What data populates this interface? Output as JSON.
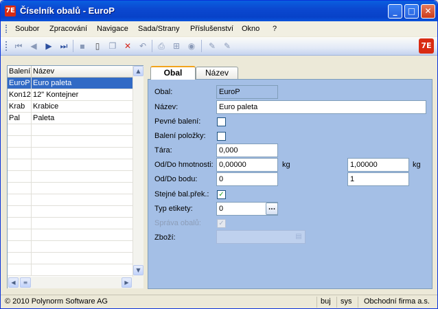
{
  "window": {
    "title": "Číselník obalů - EuroP",
    "icon_text": "7E",
    "controls": {
      "minimize": "_",
      "maximize": "□",
      "close": "✕"
    }
  },
  "menu": [
    "Soubor",
    "Zpracování",
    "Navigace",
    "Sada/Strany",
    "Příslušenství",
    "Okno",
    "?"
  ],
  "toolbar": {
    "icons": [
      "first-record-icon",
      "prev-record-icon",
      "next-record-icon",
      "last-record-icon",
      "save-icon",
      "new-icon",
      "copy-icon",
      "delete-icon",
      "undo-icon",
      "print-icon",
      "tree-icon",
      "refresh-icon",
      "edit-icon",
      "edit-alt-icon"
    ],
    "brand_text": "7E"
  },
  "grid": {
    "headers": [
      "Balení",
      "Název"
    ],
    "rows": [
      {
        "code": "EuroP",
        "name": "Euro paleta",
        "selected": true
      },
      {
        "code": "Kon12",
        "name": "12\" Kontejner"
      },
      {
        "code": "Krab",
        "name": "Krabice"
      },
      {
        "code": "Pal",
        "name": "Paleta"
      }
    ]
  },
  "tabs": [
    "Obal",
    "Název"
  ],
  "form": {
    "obal_label": "Obal:",
    "obal_value": "EuroP",
    "nazev_label": "Název:",
    "nazev_value": "Euro paleta",
    "pevne_label": "Pevné balení:",
    "pevne_checked": false,
    "baleni_pol_label": "Balení položky:",
    "baleni_pol_checked": false,
    "tara_label": "Tára:",
    "tara_value": "0,000",
    "hmot_label": "Od/Do hmotnosti:",
    "hmot_from": "0,00000",
    "hmot_to": "1,00000",
    "hmot_unit": "kg",
    "bodu_label": "Od/Do bodu:",
    "bodu_from": "0",
    "bodu_to": "1",
    "stejne_label": "Stejné bal.přek.:",
    "stejne_checked": true,
    "typ_label": "Typ etikety:",
    "typ_value": "0",
    "typ_button": "...",
    "sprava_label": "Správa obalů:",
    "sprava_checked": true,
    "zbozi_label": "Zboží:",
    "zbozi_value": ""
  },
  "status": {
    "copyright": "© 2010 Polynorm Software AG",
    "user": "buj",
    "db": "sys",
    "company": "Obchodní firma a.s."
  }
}
